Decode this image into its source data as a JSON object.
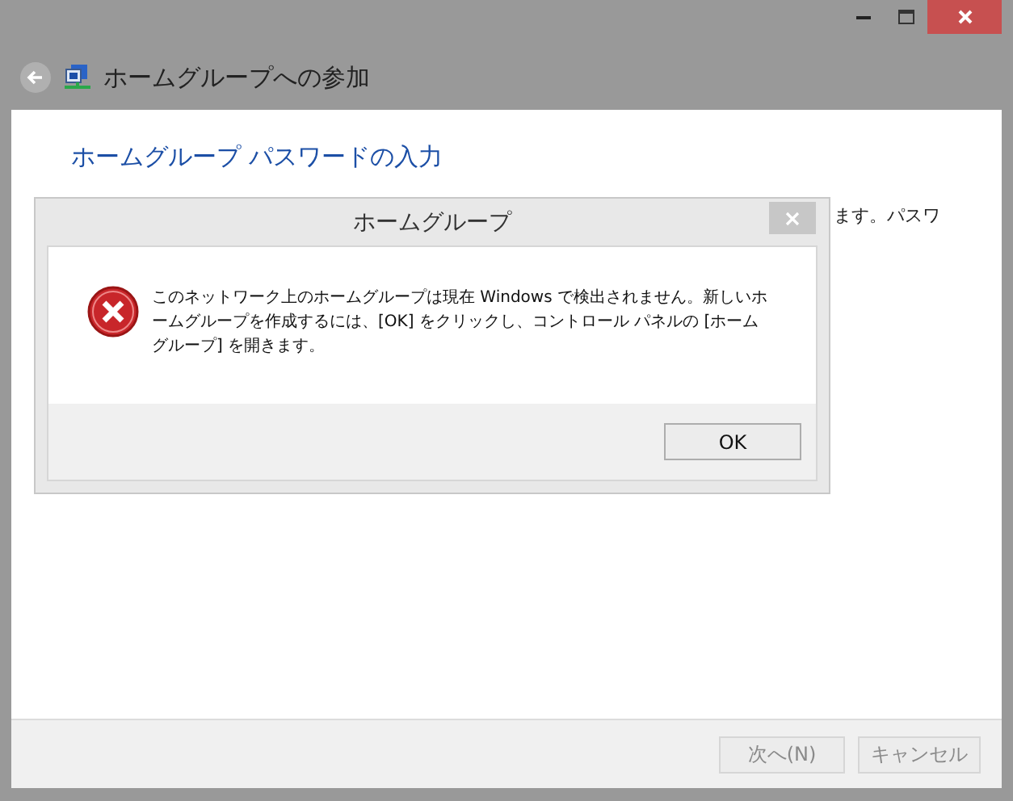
{
  "window": {
    "title": "ホームグループへの参加",
    "controls": [
      {
        "kind": "minimize"
      },
      {
        "kind": "maximize"
      },
      {
        "kind": "close"
      }
    ]
  },
  "page": {
    "heading": "ホームグループ パスワードの入力",
    "behind_text": "ます。パスワ"
  },
  "dialog": {
    "title": "ホームグループ",
    "message": "このネットワーク上のホームグループは現在 Windows で検出されません。新しいホームグループを作成するには、[OK] をクリックし、コントロール パネルの [ホームグループ] を開きます。",
    "button": "OK"
  },
  "buttons": [
    {
      "label": "次へ(N)",
      "disabled": true
    },
    {
      "label": "キャンセル",
      "disabled": true
    }
  ]
}
